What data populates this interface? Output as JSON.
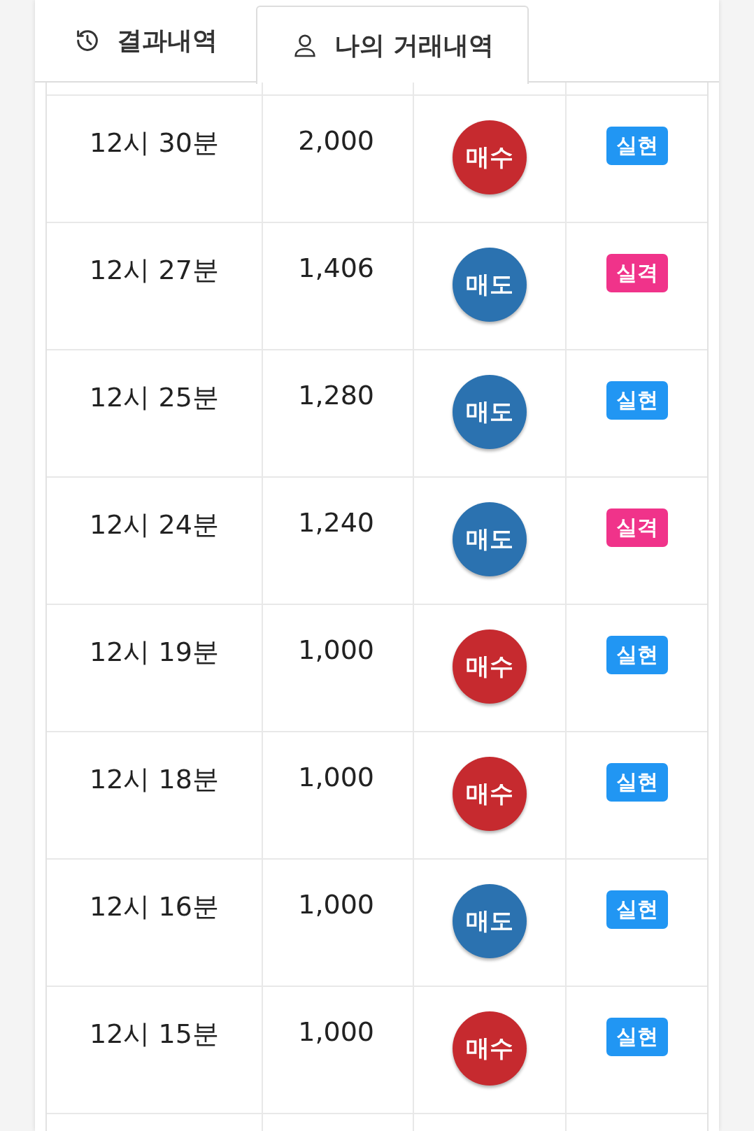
{
  "tabs": [
    {
      "label": "결과내역",
      "kind": "history",
      "selected": false
    },
    {
      "label": "나의 거래내역",
      "kind": "account",
      "selected": true
    }
  ],
  "rows": [
    {
      "time": "12시 30분",
      "amount": "2,000",
      "side": {
        "label": "매수",
        "kind": "buy"
      },
      "result": {
        "label": "실현",
        "kind": "win"
      }
    },
    {
      "time": "12시 27분",
      "amount": "1,406",
      "side": {
        "label": "매도",
        "kind": "sell"
      },
      "result": {
        "label": "실격",
        "kind": "lose"
      }
    },
    {
      "time": "12시 25분",
      "amount": "1,280",
      "side": {
        "label": "매도",
        "kind": "sell"
      },
      "result": {
        "label": "실현",
        "kind": "win"
      }
    },
    {
      "time": "12시 24분",
      "amount": "1,240",
      "side": {
        "label": "매도",
        "kind": "sell"
      },
      "result": {
        "label": "실격",
        "kind": "lose"
      }
    },
    {
      "time": "12시 19분",
      "amount": "1,000",
      "side": {
        "label": "매수",
        "kind": "buy"
      },
      "result": {
        "label": "실현",
        "kind": "win"
      }
    },
    {
      "time": "12시 18분",
      "amount": "1,000",
      "side": {
        "label": "매수",
        "kind": "buy"
      },
      "result": {
        "label": "실현",
        "kind": "win"
      }
    },
    {
      "time": "12시 16분",
      "amount": "1,000",
      "side": {
        "label": "매도",
        "kind": "sell"
      },
      "result": {
        "label": "실현",
        "kind": "win"
      }
    },
    {
      "time": "12시 15분",
      "amount": "1,000",
      "side": {
        "label": "매수",
        "kind": "buy"
      },
      "result": {
        "label": "실현",
        "kind": "win"
      }
    }
  ]
}
